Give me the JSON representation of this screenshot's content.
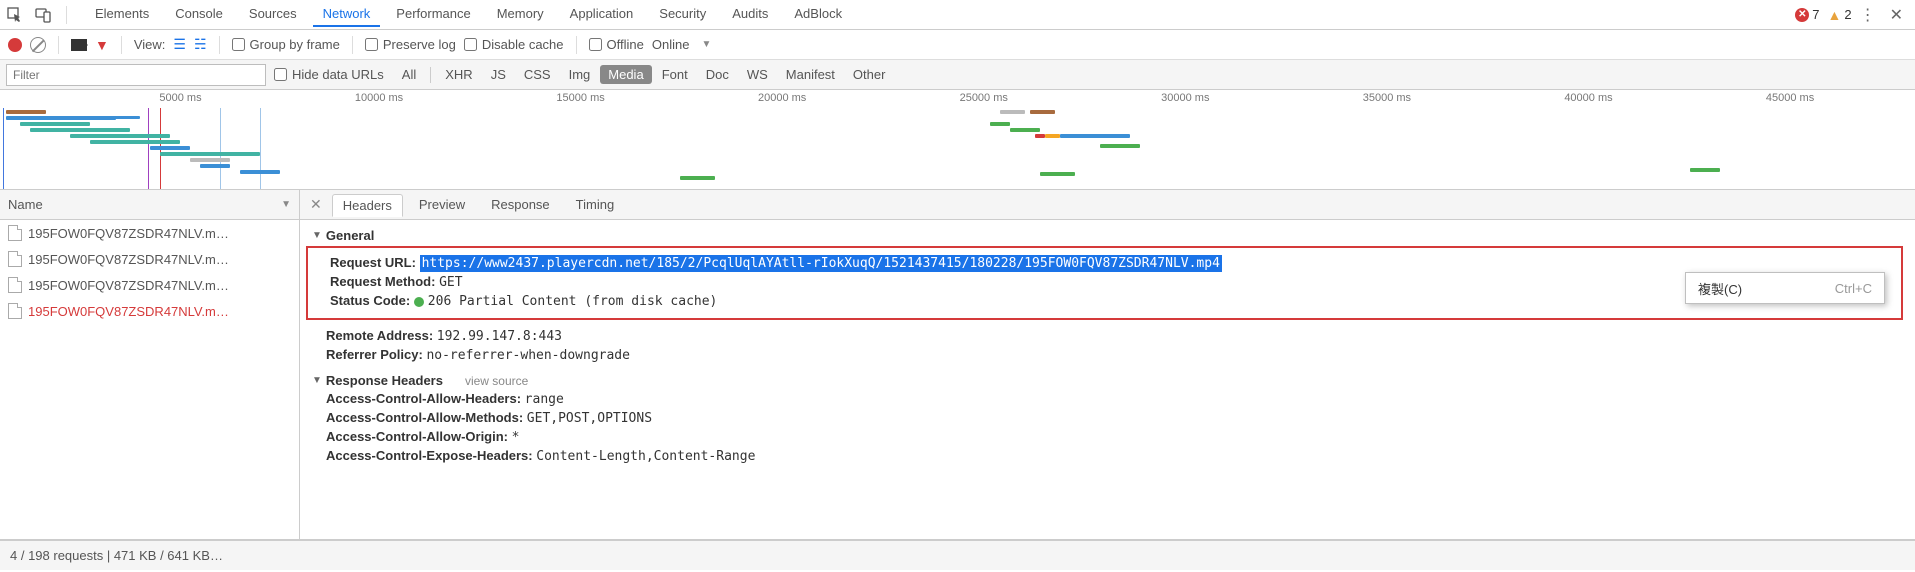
{
  "topbar": {
    "tabs": [
      "Elements",
      "Console",
      "Sources",
      "Network",
      "Performance",
      "Memory",
      "Application",
      "Security",
      "Audits",
      "AdBlock"
    ],
    "active_index": 3,
    "errors": 7,
    "warnings": 2
  },
  "toolbar": {
    "view_label": "View:",
    "group_by_frame": "Group by frame",
    "preserve_log": "Preserve log",
    "disable_cache": "Disable cache",
    "offline": "Offline",
    "online": "Online"
  },
  "filterbar": {
    "placeholder": "Filter",
    "hide_data_urls": "Hide data URLs",
    "types": [
      "All",
      "XHR",
      "JS",
      "CSS",
      "Img",
      "Media",
      "Font",
      "Doc",
      "WS",
      "Manifest",
      "Other"
    ],
    "active_type_index": 5
  },
  "overview": {
    "ticks_ms": [
      5000,
      10000,
      15000,
      20000,
      25000,
      30000,
      35000,
      40000,
      45000
    ]
  },
  "name_panel": {
    "header": "Name",
    "items": [
      {
        "label": "195FOW0FQV87ZSDR47NLV.m…",
        "selected": false
      },
      {
        "label": "195FOW0FQV87ZSDR47NLV.m…",
        "selected": false
      },
      {
        "label": "195FOW0FQV87ZSDR47NLV.m…",
        "selected": false
      },
      {
        "label": "195FOW0FQV87ZSDR47NLV.m…",
        "selected": true
      }
    ]
  },
  "detail": {
    "tabs": [
      "Headers",
      "Preview",
      "Response",
      "Timing"
    ],
    "active_index": 0,
    "sections": {
      "general": {
        "title": "General",
        "request_url_label": "Request URL:",
        "request_url_value": "https://www2437.playercdn.net/185/2/PcqlUqlAYAtll-rIokXuqQ/1521437415/180228/195FOW0FQV87ZSDR47NLV.mp4",
        "request_method_label": "Request Method:",
        "request_method_value": "GET",
        "status_code_label": "Status Code:",
        "status_code_value": "206 Partial Content (from disk cache)",
        "remote_address_label": "Remote Address:",
        "remote_address_value": "192.99.147.8:443",
        "referrer_policy_label": "Referrer Policy:",
        "referrer_policy_value": "no-referrer-when-downgrade"
      },
      "response_headers": {
        "title": "Response Headers",
        "view_source": "view source",
        "items": [
          {
            "k": "Access-Control-Allow-Headers:",
            "v": "range"
          },
          {
            "k": "Access-Control-Allow-Methods:",
            "v": "GET,POST,OPTIONS"
          },
          {
            "k": "Access-Control-Allow-Origin:",
            "v": "*"
          },
          {
            "k": "Access-Control-Expose-Headers:",
            "v": "Content-Length,Content-Range"
          }
        ]
      }
    }
  },
  "context_menu": {
    "copy_label": "複製(C)",
    "copy_shortcut": "Ctrl+C"
  },
  "footer": {
    "text": "4 / 198 requests  |  471 KB / 641 KB…"
  }
}
